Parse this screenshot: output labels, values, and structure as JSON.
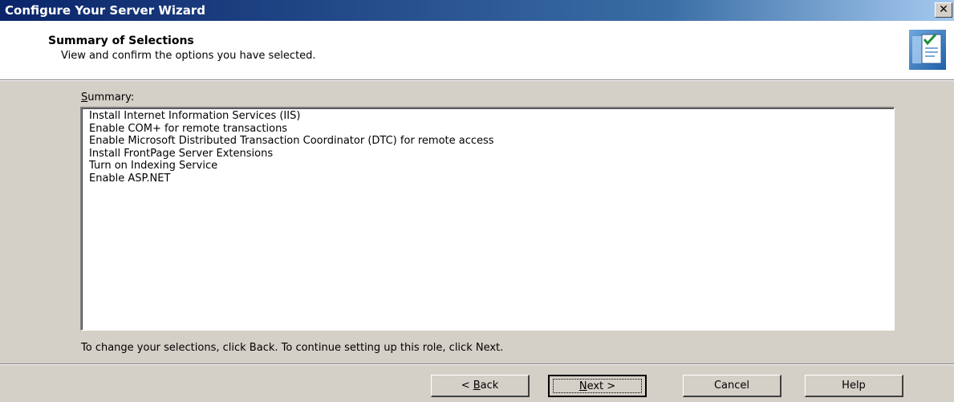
{
  "window": {
    "title": "Configure Your Server Wizard",
    "close_glyph": "✕"
  },
  "header": {
    "title": "Summary of Selections",
    "subtitle": "View and confirm the options you have selected.",
    "icon": "wizard-document-check-icon"
  },
  "summary": {
    "label_accel": "S",
    "label_rest": "ummary:",
    "items": [
      "Install Internet Information Services (IIS)",
      "Enable COM+ for remote transactions",
      "Enable Microsoft Distributed Transaction Coordinator (DTC) for remote access",
      "Install FrontPage Server Extensions",
      "Turn on Indexing Service",
      "Enable ASP.NET"
    ]
  },
  "instruction": "To change your selections, click Back. To continue setting up this role, click Next.",
  "buttons": {
    "back_prefix": "< ",
    "back_accel": "B",
    "back_rest": "ack",
    "next_accel": "N",
    "next_rest": "ext >",
    "cancel": "Cancel",
    "help": "Help"
  },
  "colors": {
    "title_bar_start": "#0a246a",
    "title_bar_end": "#a6caf0",
    "dialog_face": "#d4d0c8"
  }
}
